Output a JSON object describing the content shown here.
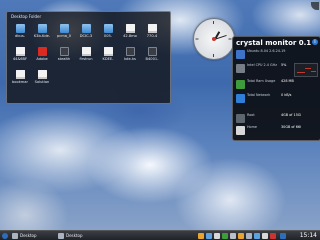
{
  "desktop": {
    "folder_view": {
      "title": "Desktop Folder",
      "files": [
        {
          "label": "dbus-",
          "icon": "folder-icon"
        },
        {
          "label": "K3b-Kde-",
          "icon": "folder-icon"
        },
        {
          "label": "pcma_0",
          "icon": "folder-icon"
        },
        {
          "label": "DCIC-3",
          "icon": "folder-icon"
        },
        {
          "label": "005-",
          "icon": "folder-icon"
        },
        {
          "label": "42.8mo",
          "icon": "doc-icon"
        },
        {
          "label": "770-4",
          "icon": "doc-icon"
        },
        {
          "label": "44&6BF",
          "icon": "doc-icon"
        },
        {
          "label": "Adobe",
          "icon": "red-icon"
        },
        {
          "label": "stealth",
          "icon": "dark-icon"
        },
        {
          "label": "firstrun",
          "icon": "doc-icon"
        },
        {
          "label": "KDEE-",
          "icon": "doc-icon"
        },
        {
          "label": "kde-ks",
          "icon": "dark-icon"
        },
        {
          "label": "B4001-",
          "icon": "dark-icon"
        },
        {
          "label": "bookmar",
          "icon": "doc-icon"
        },
        {
          "label": "Solution",
          "icon": "doc-icon"
        }
      ]
    },
    "crystal_monitor": {
      "title": "crystal monitor 0.1",
      "rows": [
        {
          "text": "Ubuntu 8.04 2.6.24-19",
          "value": "",
          "color": "#3d74c9"
        },
        {
          "text": "Intel CPU 2.4 GHz",
          "value": "5%",
          "color": "#777e88"
        },
        {
          "text": "Total Ram Usage",
          "value": "428 MB",
          "color": "#3e9c3a"
        },
        {
          "text": "Total Network",
          "value": "0 kB/s",
          "color": "#2f7fd8"
        },
        {
          "text": "Root",
          "value": "4GB of 15GB",
          "color": "#5d666f"
        },
        {
          "text": "Home",
          "value": "30GB of 66GB",
          "color": "#d8d8d8"
        }
      ]
    },
    "taskbar": {
      "items": [
        "",
        "Desktop",
        "Desktop"
      ],
      "clock": "15:14"
    }
  }
}
